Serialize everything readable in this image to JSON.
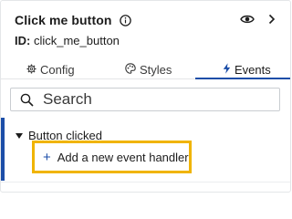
{
  "header": {
    "title": "Click me button",
    "id_key": "ID:",
    "id_value": "click_me_button",
    "info_icon": "info-icon",
    "visibility_icon": "eye-icon",
    "expand_icon": "chevron-right-icon"
  },
  "tabs": [
    {
      "label": "Config",
      "icon": "gear-icon",
      "active": false
    },
    {
      "label": "Styles",
      "icon": "palette-icon",
      "active": false
    },
    {
      "label": "Events",
      "icon": "lightning-icon",
      "active": true
    }
  ],
  "search": {
    "placeholder": "Search",
    "value": ""
  },
  "events": {
    "section_label": "Button clicked",
    "add_handler_label": "Add a new event handler"
  },
  "colors": {
    "accent": "#1c4ea8",
    "highlight": "#f0b400"
  }
}
